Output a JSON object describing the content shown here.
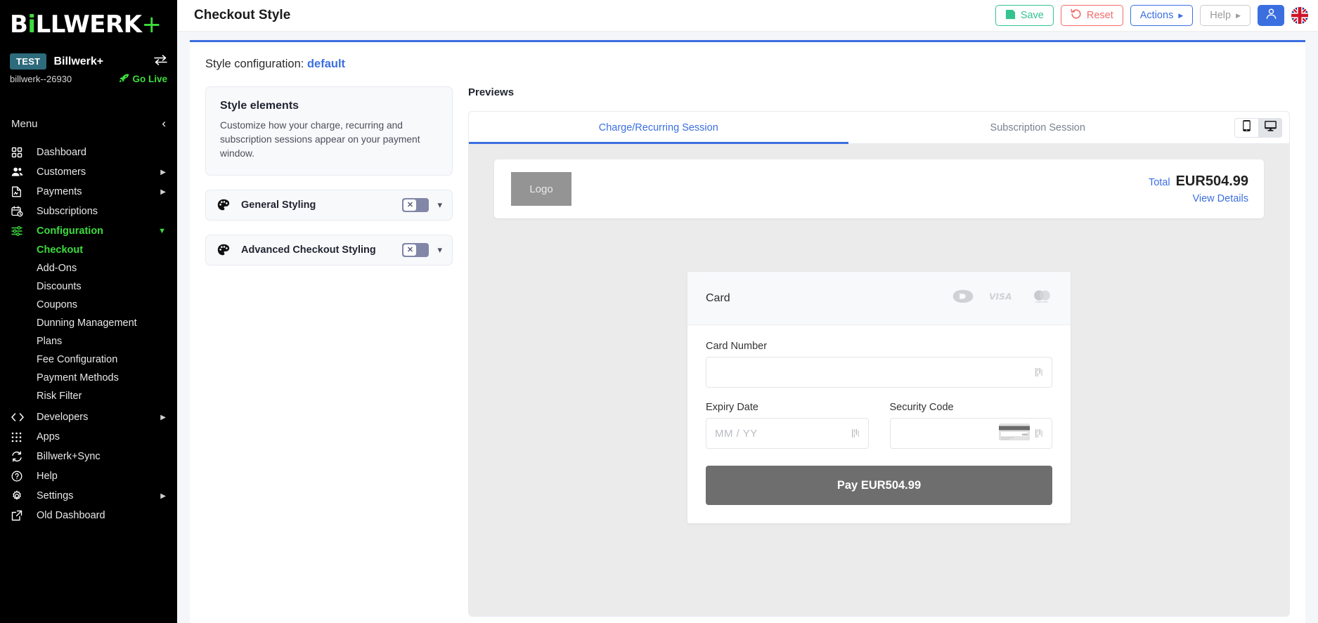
{
  "sidebar": {
    "logo": {
      "before": "B",
      "dot": "i",
      "after": "LLWERK",
      "plus": "+"
    },
    "account": {
      "env_badge": "TEST",
      "name": "Billwerk+",
      "id": "billwerk--26930",
      "go_live": "Go Live"
    },
    "menu_label": "Menu",
    "items": [
      {
        "label": "Dashboard",
        "icon": "grid-icon",
        "has_arrow": false,
        "active": false,
        "type": "item"
      },
      {
        "label": "Customers",
        "icon": "users-icon",
        "has_arrow": true,
        "active": false,
        "type": "item"
      },
      {
        "label": "Payments",
        "icon": "document-icon",
        "has_arrow": true,
        "active": false,
        "type": "item"
      },
      {
        "label": "Subscriptions",
        "icon": "calendar-clock-icon",
        "has_arrow": false,
        "active": false,
        "type": "item"
      },
      {
        "label": "Configuration",
        "icon": "sliders-icon",
        "has_arrow": true,
        "active": true,
        "type": "item"
      },
      {
        "label": "Checkout",
        "icon": "",
        "has_arrow": false,
        "active": true,
        "type": "sub"
      },
      {
        "label": "Add-Ons",
        "icon": "",
        "has_arrow": false,
        "active": false,
        "type": "sub"
      },
      {
        "label": "Discounts",
        "icon": "",
        "has_arrow": false,
        "active": false,
        "type": "sub"
      },
      {
        "label": "Coupons",
        "icon": "",
        "has_arrow": false,
        "active": false,
        "type": "sub"
      },
      {
        "label": "Dunning Management",
        "icon": "",
        "has_arrow": false,
        "active": false,
        "type": "sub"
      },
      {
        "label": "Plans",
        "icon": "",
        "has_arrow": false,
        "active": false,
        "type": "sub"
      },
      {
        "label": "Fee Configuration",
        "icon": "",
        "has_arrow": false,
        "active": false,
        "type": "sub"
      },
      {
        "label": "Payment Methods",
        "icon": "",
        "has_arrow": false,
        "active": false,
        "type": "sub"
      },
      {
        "label": "Risk Filter",
        "icon": "",
        "has_arrow": false,
        "active": false,
        "type": "sub"
      },
      {
        "label": "Developers",
        "icon": "code-icon",
        "has_arrow": true,
        "active": false,
        "type": "item"
      },
      {
        "label": "Apps",
        "icon": "apps-grid-icon",
        "has_arrow": false,
        "active": false,
        "type": "item"
      },
      {
        "label": "Billwerk+Sync",
        "icon": "sync-icon",
        "has_arrow": false,
        "active": false,
        "type": "item"
      },
      {
        "label": "Help",
        "icon": "question-circle-icon",
        "has_arrow": false,
        "active": false,
        "type": "item"
      },
      {
        "label": "Settings",
        "icon": "gear-icon",
        "has_arrow": true,
        "active": false,
        "type": "item"
      },
      {
        "label": "Old Dashboard",
        "icon": "external-link-icon",
        "has_arrow": false,
        "active": false,
        "type": "item"
      }
    ]
  },
  "header": {
    "title": "Checkout Style",
    "buttons": {
      "save": "Save",
      "reset": "Reset",
      "actions": "Actions",
      "help": "Help"
    }
  },
  "style_config": {
    "label": "Style configuration:",
    "value": "default"
  },
  "style_elements": {
    "title": "Style elements",
    "description": "Customize how your charge, recurring and subscription sessions appear on your payment window.",
    "rows": [
      {
        "label": "General Styling",
        "icon": "palette-icon",
        "toggle_state": "off",
        "toggle_glyph": "✕"
      },
      {
        "label": "Advanced Checkout Styling",
        "icon": "palette-icon",
        "toggle_state": "off",
        "toggle_glyph": "✕"
      }
    ]
  },
  "previews": {
    "title": "Previews",
    "tabs": [
      {
        "label": "Charge/Recurring Session",
        "active": true
      },
      {
        "label": "Subscription Session",
        "active": false
      }
    ],
    "device_toggle": [
      {
        "name": "mobile",
        "active": false
      },
      {
        "name": "desktop",
        "active": true
      }
    ],
    "checkout": {
      "logo_placeholder": "Logo",
      "total_label": "Total",
      "total_value": "EUR504.99",
      "view_details": "View Details",
      "card_section_title": "Card",
      "brands": [
        "dankort",
        "visa",
        "mastercard"
      ],
      "fields": {
        "card_number_label": "Card Number",
        "card_number_value": "",
        "expiry_label": "Expiry Date",
        "expiry_placeholder": "MM / YY",
        "expiry_value": "",
        "security_label": "Security Code",
        "security_value": ""
      },
      "pay_button": "Pay EUR504.99"
    }
  },
  "colors": {
    "accent_blue": "#3b6fe0",
    "brand_green": "#3ddc3d",
    "save_green": "#34c38f",
    "reset_red": "#f46a6a",
    "sidebar_bg": "#000000"
  }
}
